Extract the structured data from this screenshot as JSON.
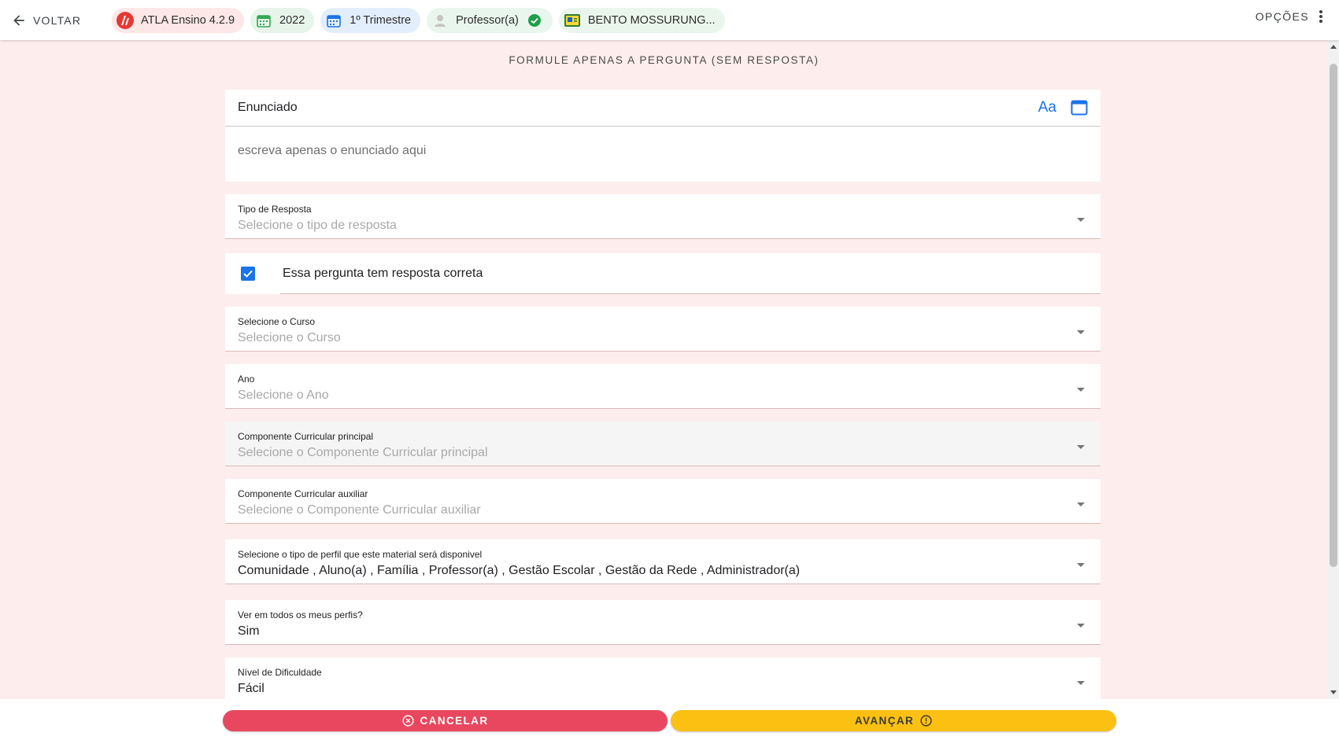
{
  "topbar": {
    "back_label": "VOLTAR",
    "chips": {
      "app": "ATLA Ensino 4.2.9",
      "year": "2022",
      "term": "1º Trimestre",
      "role": "Professor(a)",
      "school": "BENTO MOSSURUNG..."
    },
    "options_label": "OPÇÕES"
  },
  "page_heading": "FORMULE APENAS A PERGUNTA (SEM RESPOSTA)",
  "enunciado": {
    "title": "Enunciado",
    "font_button": "Aa",
    "placeholder": "escreva apenas o enunciado aqui"
  },
  "fields": {
    "tipo_resposta": {
      "label": "Tipo de Resposta",
      "value": "Selecione o tipo de resposta"
    },
    "curso": {
      "label": "Selecione o Curso",
      "value": "Selecione o Curso"
    },
    "ano": {
      "label": "Ano",
      "value": "Selecione o Ano"
    },
    "componente_principal": {
      "label": "Componente Curricular principal",
      "value": "Selecione o Componente Curricular principal"
    },
    "componente_auxiliar": {
      "label": "Componente Curricular auxiliar",
      "value": "Selecione o Componente Curricular auxiliar"
    },
    "perfil": {
      "label": "Selecione o tipo de perfil que este material será disponivel",
      "value": "Comunidade , Aluno(a) , Família , Professor(a) , Gestão Escolar , Gestão da Rede , Administrador(a)"
    },
    "todos_perfis": {
      "label": "Ver em todos os meus perfis?",
      "value": "Sim"
    },
    "dificuldade": {
      "label": "Nível de Dificuldade",
      "value": "Fácil"
    }
  },
  "checkbox": {
    "label": "Essa pergunta tem resposta correta",
    "checked": true
  },
  "actions": {
    "cancel_label": "CANCELAR",
    "next_label": "AVANÇAR"
  },
  "colors": {
    "background": "#fdeeed",
    "accent_blue": "#1a73e8",
    "cancel": "#e8475f",
    "next": "#fbc012",
    "success": "#1e9e4a"
  },
  "icons": [
    "arrow-left-icon",
    "atla-logo-icon",
    "calendar-icon",
    "user-avatar-icon",
    "check-circle-icon",
    "school-card-icon",
    "more-vert-icon",
    "window-icon",
    "cancel-circle-icon",
    "info-circle-icon",
    "chevron-down-icon"
  ]
}
